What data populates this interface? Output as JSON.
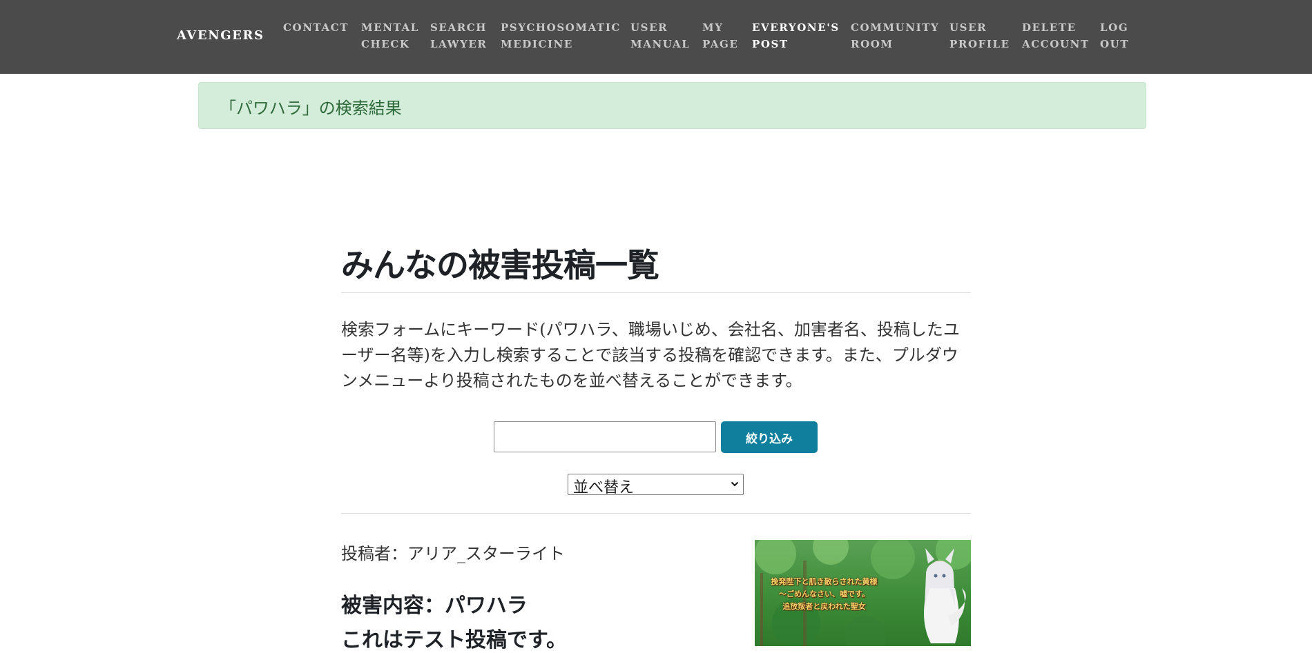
{
  "nav": {
    "brand": "AVENGERS",
    "items": [
      {
        "line1": "CONTACT",
        "line2": "",
        "active": false
      },
      {
        "line1": "MENTAL",
        "line2": "CHECK",
        "active": false
      },
      {
        "line1": "SEARCH",
        "line2": "LAWYER",
        "active": false
      },
      {
        "line1": "PSYCHOSOMATIC",
        "line2": "MEDICINE",
        "active": false
      },
      {
        "line1": "USER",
        "line2": "MANUAL",
        "active": false
      },
      {
        "line1": "MY",
        "line2": "PAGE",
        "active": false
      },
      {
        "line1": "EVERYONE'S",
        "line2": "POST",
        "active": true
      },
      {
        "line1": "COMMUNITY",
        "line2": "ROOM",
        "active": false
      },
      {
        "line1": "USER",
        "line2": "PROFILE",
        "active": false
      },
      {
        "line1": "DELETE",
        "line2": "ACCOUNT",
        "active": false
      },
      {
        "line1": "LOG",
        "line2": "OUT",
        "active": false
      }
    ]
  },
  "alert": {
    "text": "「パワハラ」の検索結果"
  },
  "main": {
    "title": "みんなの被害投稿一覧",
    "description": "検索フォームにキーワード(パワハラ、職場いじめ、会社名、加害者名、投稿したユーザー名等)を入力し検索することで該当する投稿を確認できます。また、プルダウンメニューより投稿されたものを並べ替えることができます。"
  },
  "search": {
    "value": "",
    "placeholder": "",
    "button_label": "絞り込み"
  },
  "sort": {
    "selected": "並べ替え"
  },
  "post": {
    "author_label": "投稿者：",
    "author_name": "アリア_スターライト",
    "damage_label": "被害内容：",
    "damage_value": "パワハラ",
    "body": "これはテスト投稿です。",
    "thumbnail_caption": [
      "挽発陛下と肌き散らされた黄様",
      "〜ごめんなさい、嘘です。",
      "追放叛者と戻われた聖女"
    ]
  },
  "colors": {
    "navbar": "#4b4b4b",
    "alert_bg": "#d4eddb",
    "alert_text": "#2f6b3a",
    "button": "#107f9e"
  }
}
